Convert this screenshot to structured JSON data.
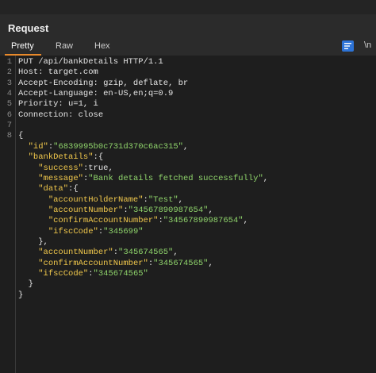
{
  "panel": {
    "title": "Request",
    "tabs": [
      "Pretty",
      "Raw",
      "Hex"
    ],
    "newline_label": "\\n"
  },
  "lines": [
    {
      "n": "1",
      "tokens": [
        {
          "c": "t-txt",
          "t": "PUT /api/bankDetails HTTP/1.1"
        }
      ]
    },
    {
      "n": "2",
      "tokens": [
        {
          "c": "t-txt",
          "t": "Host: target.com"
        }
      ]
    },
    {
      "n": "3",
      "tokens": [
        {
          "c": "t-txt",
          "t": "Accept-Encoding: gzip, deflate, br"
        }
      ]
    },
    {
      "n": "4",
      "tokens": [
        {
          "c": "t-txt",
          "t": "Accept-Language: en-US,en;q=0.9"
        }
      ]
    },
    {
      "n": "5",
      "tokens": [
        {
          "c": "t-txt",
          "t": "Priority: u=1, i"
        }
      ]
    },
    {
      "n": "6",
      "tokens": [
        {
          "c": "t-txt",
          "t": "Connection: close"
        }
      ]
    },
    {
      "n": "7",
      "tokens": []
    },
    {
      "n": "8",
      "tokens": [
        {
          "c": "t-punc",
          "t": "{"
        }
      ]
    },
    {
      "n": "",
      "tokens": [
        {
          "c": "t-punc",
          "t": "  "
        },
        {
          "c": "t-key",
          "t": "\"id\""
        },
        {
          "c": "t-punc",
          "t": ":"
        },
        {
          "c": "t-str",
          "t": "\"6839995b0c731d370c6ac315\""
        },
        {
          "c": "t-punc",
          "t": ","
        }
      ]
    },
    {
      "n": "",
      "tokens": [
        {
          "c": "t-punc",
          "t": "  "
        },
        {
          "c": "t-key",
          "t": "\"bankDetails\""
        },
        {
          "c": "t-punc",
          "t": ":{"
        }
      ]
    },
    {
      "n": "",
      "tokens": [
        {
          "c": "t-punc",
          "t": "    "
        },
        {
          "c": "t-key",
          "t": "\"success\""
        },
        {
          "c": "t-punc",
          "t": ":"
        },
        {
          "c": "t-bool",
          "t": "true"
        },
        {
          "c": "t-punc",
          "t": ","
        }
      ]
    },
    {
      "n": "",
      "tokens": [
        {
          "c": "t-punc",
          "t": "    "
        },
        {
          "c": "t-key",
          "t": "\"message\""
        },
        {
          "c": "t-punc",
          "t": ":"
        },
        {
          "c": "t-str",
          "t": "\"Bank details fetched successfully\""
        },
        {
          "c": "t-punc",
          "t": ","
        }
      ]
    },
    {
      "n": "",
      "tokens": [
        {
          "c": "t-punc",
          "t": "    "
        },
        {
          "c": "t-key",
          "t": "\"data\""
        },
        {
          "c": "t-punc",
          "t": ":{"
        }
      ]
    },
    {
      "n": "",
      "tokens": [
        {
          "c": "t-punc",
          "t": "      "
        },
        {
          "c": "t-key",
          "t": "\"accountHolderName\""
        },
        {
          "c": "t-punc",
          "t": ":"
        },
        {
          "c": "t-str",
          "t": "\"Test\""
        },
        {
          "c": "t-punc",
          "t": ","
        }
      ]
    },
    {
      "n": "",
      "tokens": [
        {
          "c": "t-punc",
          "t": "      "
        },
        {
          "c": "t-key",
          "t": "\"accountNumber\""
        },
        {
          "c": "t-punc",
          "t": ":"
        },
        {
          "c": "t-str",
          "t": "\"34567890987654\""
        },
        {
          "c": "t-punc",
          "t": ","
        }
      ]
    },
    {
      "n": "",
      "tokens": [
        {
          "c": "t-punc",
          "t": "      "
        },
        {
          "c": "t-key",
          "t": "\"confirmAccountNumber\""
        },
        {
          "c": "t-punc",
          "t": ":"
        },
        {
          "c": "t-str",
          "t": "\"34567890987654\""
        },
        {
          "c": "t-punc",
          "t": ","
        }
      ]
    },
    {
      "n": "",
      "tokens": [
        {
          "c": "t-punc",
          "t": "      "
        },
        {
          "c": "t-key",
          "t": "\"ifscCode\""
        },
        {
          "c": "t-punc",
          "t": ":"
        },
        {
          "c": "t-str",
          "t": "\"345699\""
        }
      ]
    },
    {
      "n": "",
      "tokens": [
        {
          "c": "t-punc",
          "t": "    },"
        }
      ]
    },
    {
      "n": "",
      "tokens": [
        {
          "c": "t-punc",
          "t": "    "
        },
        {
          "c": "t-key",
          "t": "\"accountNumber\""
        },
        {
          "c": "t-punc",
          "t": ":"
        },
        {
          "c": "t-str",
          "t": "\"345674565\""
        },
        {
          "c": "t-punc",
          "t": ","
        }
      ]
    },
    {
      "n": "",
      "tokens": [
        {
          "c": "t-punc",
          "t": "    "
        },
        {
          "c": "t-key",
          "t": "\"confirmAccountNumber\""
        },
        {
          "c": "t-punc",
          "t": ":"
        },
        {
          "c": "t-str",
          "t": "\"345674565\""
        },
        {
          "c": "t-punc",
          "t": ","
        }
      ]
    },
    {
      "n": "",
      "tokens": [
        {
          "c": "t-punc",
          "t": "    "
        },
        {
          "c": "t-key",
          "t": "\"ifscCode\""
        },
        {
          "c": "t-punc",
          "t": ":"
        },
        {
          "c": "t-str",
          "t": "\"345674565\""
        }
      ]
    },
    {
      "n": "",
      "tokens": [
        {
          "c": "t-punc",
          "t": "  }"
        }
      ]
    },
    {
      "n": "",
      "tokens": [
        {
          "c": "t-punc",
          "t": "}"
        }
      ]
    }
  ],
  "colors": {
    "accent_tab": "#e8892b",
    "json_key": "#f2c94c",
    "json_string": "#8fd46b",
    "button_blue": "#2d73d6"
  }
}
